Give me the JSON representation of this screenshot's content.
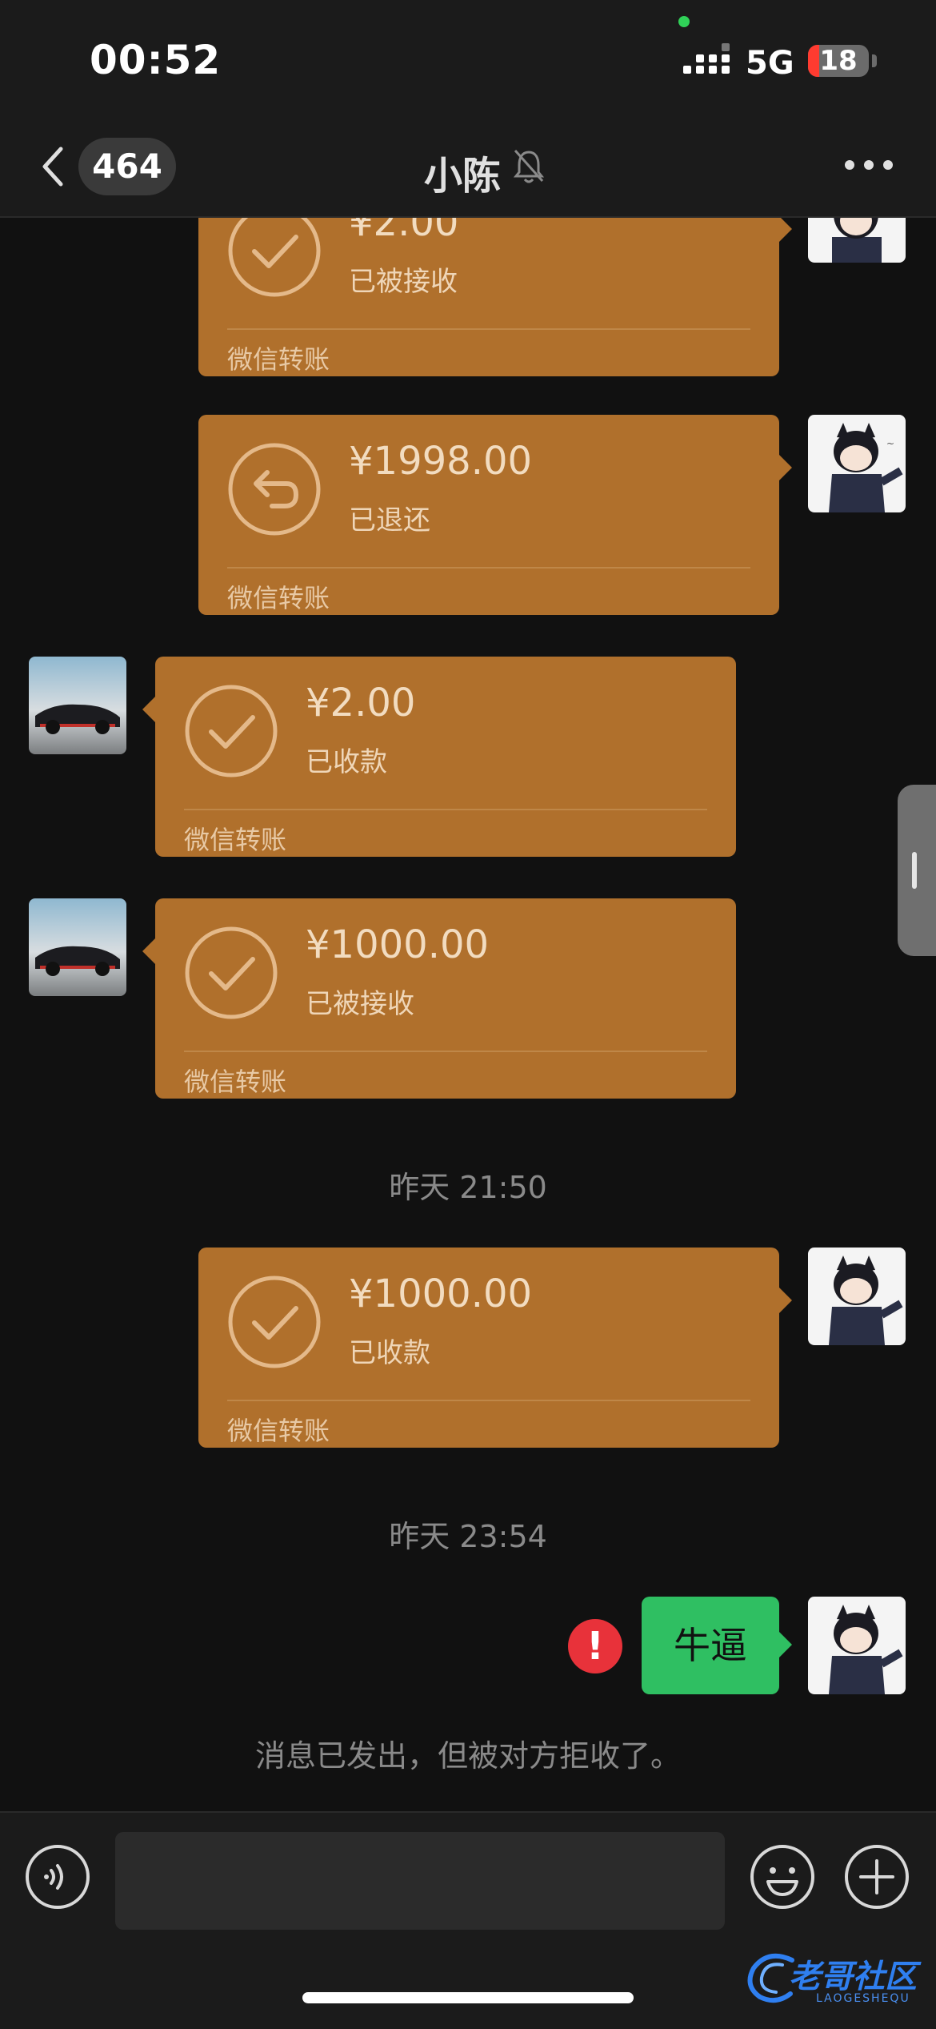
{
  "status_bar": {
    "time": "00:52",
    "network": "5G",
    "battery_level": "18",
    "battery_fraction": 0.18
  },
  "nav": {
    "unread_count": "464",
    "title": "小陈",
    "icons": [
      "chevron-left-icon",
      "bell-slash-icon",
      "more-horizontal-icon"
    ]
  },
  "messages": [
    {
      "type": "transfer",
      "side": "right",
      "amount": "¥2.00",
      "status": "已被接收",
      "label": "微信转账",
      "icon": "check-circle-icon"
    },
    {
      "type": "transfer",
      "side": "right",
      "amount": "¥1998.00",
      "status": "已退还",
      "label": "微信转账",
      "icon": "return-circle-icon"
    },
    {
      "type": "transfer",
      "side": "left",
      "amount": "¥2.00",
      "status": "已收款",
      "label": "微信转账",
      "icon": "check-circle-icon"
    },
    {
      "type": "transfer",
      "side": "left",
      "amount": "¥1000.00",
      "status": "已被接收",
      "label": "微信转账",
      "icon": "check-circle-icon"
    },
    {
      "type": "timestamp",
      "text": "昨天 21:50"
    },
    {
      "type": "transfer",
      "side": "right",
      "amount": "¥1000.00",
      "status": "已收款",
      "label": "微信转账",
      "icon": "check-circle-icon"
    },
    {
      "type": "timestamp",
      "text": "昨天 23:54"
    },
    {
      "type": "text",
      "side": "right",
      "text": "牛逼",
      "error": "!"
    },
    {
      "type": "system",
      "text": "消息已发出，但被对方拒收了。"
    }
  ],
  "input_bar": {
    "placeholder": "",
    "icons": [
      "voice-icon",
      "emoji-icon",
      "plus-icon"
    ]
  },
  "watermark": {
    "text": "老哥社区",
    "sub": "LAOGESHEQU"
  },
  "colors": {
    "transfer_card": "#b0702c",
    "sent_bubble": "#2fbf62",
    "error": "#e8323a",
    "background": "#111111"
  }
}
